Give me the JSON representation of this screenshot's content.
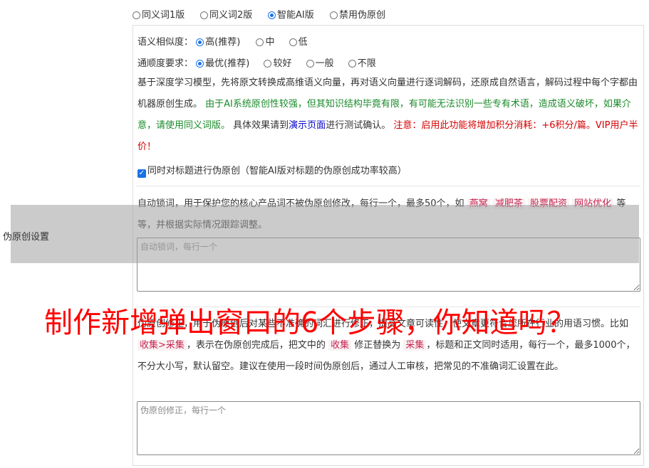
{
  "versions": {
    "options": [
      "同义词1版",
      "同义词2版",
      "智能AI版",
      "禁用伪原创"
    ],
    "selected": "智能AI版"
  },
  "similarity": {
    "label": "语义相似度：",
    "options": [
      "高(推荐)",
      "中",
      "低"
    ],
    "selected": "高(推荐)"
  },
  "fluency": {
    "label": "通顺度要求：",
    "options": [
      "最优(推荐)",
      "较好",
      "一般",
      "不限"
    ],
    "selected": "最优(推荐)"
  },
  "description": {
    "text1": "基于深度学习模型，先将原文转换成高维语义向量，再对语义向量进行逐词解码，还原成自然语言，解码过程中每个字都由机器原创生成。",
    "warning_green": "由于AI系统原创性较强，但其知识结构毕竟有限，有可能无法识别一些专有术语，造成语义破坏，如果介意，请使用同义词版。",
    "text2": "具体效果请到",
    "demo_link": "演示页面",
    "text3": "进行测试确认。",
    "notice_red": "注意：启用此功能将增加积分消耗：+6积分/篇。VIP用户半价！"
  },
  "title_checkbox": {
    "checked": true,
    "label": "同时对标题进行伪原创（智能AI版对标题的伪原创成功率较高）"
  },
  "lock_words": {
    "desc_prefix": "自动锁词，用于保护您的核心产品词不被伪原创修改，每行一个，最多50个，如",
    "examples": [
      "燕窝",
      "减肥茶",
      "股票配资",
      "网站优化"
    ],
    "desc_suffix": "等等，并根据实际情况跟踪调整。",
    "placeholder": "自动锁词，每行一个"
  },
  "correction": {
    "desc_prefix": "伪原创修正，用于伪原创后对某些不准确的词汇进行修正，提高文章可读性，使文章更符合您所在行业的用语习惯。比如",
    "example_rule": "收集>采集",
    "desc_mid1": "，表示在伪原创完成后，把文中的",
    "example_from": "收集",
    "desc_mid2": "修正替换为",
    "example_to": "采集",
    "desc_suffix": "，标题和正文同时适用，每行一个，最多1000个，不分大小写，默认留空。建议在使用一段时间伪原创后，通过人工审核，把常见的不准确词汇设置在此。",
    "placeholder": "伪原创修正，每行一个"
  },
  "side_label": "伪原创设置",
  "overlay_title": "制作新增弹出窗口的6个步骤，你知道吗？",
  "colors": {
    "accent": "#1a73e8",
    "green": "#1a8a2a",
    "red": "#d40000",
    "overlay": "#ff0000"
  }
}
